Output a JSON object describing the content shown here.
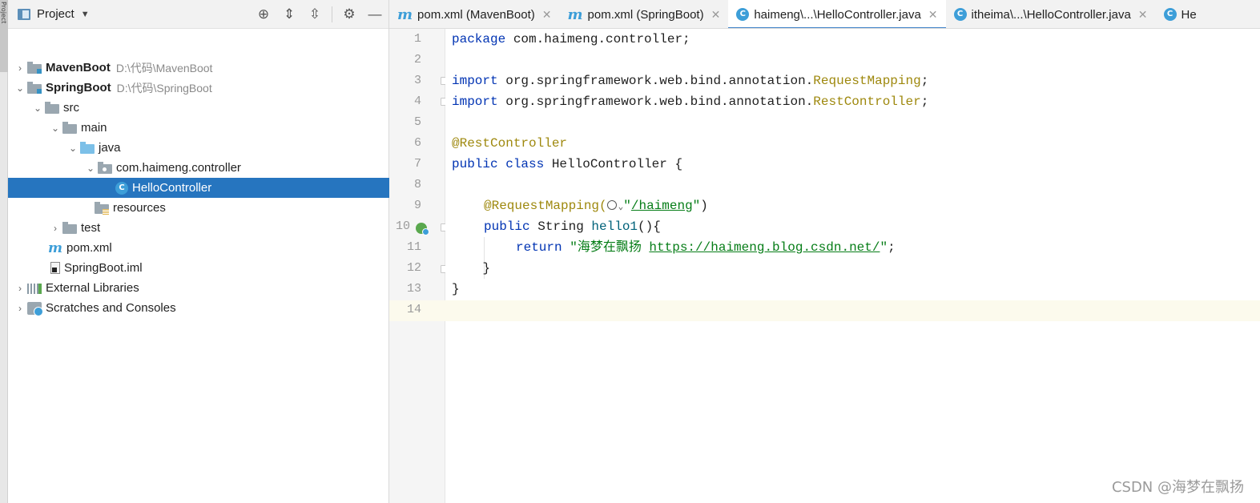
{
  "side_strip": {
    "label": "Project"
  },
  "project_panel": {
    "title": "Project",
    "tools": [
      "locate-icon",
      "expand-all-icon",
      "collapse-all-icon",
      "gear-icon",
      "minimize-icon"
    ],
    "tree": [
      {
        "label": "MavenBoot",
        "path": "D:\\代码\\MavenBoot",
        "bold": true
      },
      {
        "label": "SpringBoot",
        "path": "D:\\代码\\SpringBoot",
        "bold": true
      },
      {
        "label": "src"
      },
      {
        "label": "main"
      },
      {
        "label": "java"
      },
      {
        "label": "com.haimeng.controller"
      },
      {
        "label": "HelloController",
        "selected": true
      },
      {
        "label": "resources"
      },
      {
        "label": "test"
      },
      {
        "label": "pom.xml"
      },
      {
        "label": "SpringBoot.iml"
      },
      {
        "label": "External Libraries"
      },
      {
        "label": "Scratches and Consoles"
      }
    ]
  },
  "tabs": [
    {
      "label": "pom.xml (MavenBoot)",
      "icon": "maven-icon"
    },
    {
      "label": "pom.xml (SpringBoot)",
      "icon": "maven-icon"
    },
    {
      "label": "haimeng\\...\\HelloController.java",
      "icon": "class-icon",
      "active": true
    },
    {
      "label": "itheima\\...\\HelloController.java",
      "icon": "class-icon"
    },
    {
      "label": "He",
      "icon": "class-icon"
    }
  ],
  "editor": {
    "line_numbers": [
      "1",
      "2",
      "3",
      "4",
      "5",
      "6",
      "7",
      "8",
      "9",
      "10",
      "11",
      "12",
      "13",
      "14"
    ],
    "current_line": 14,
    "code": {
      "l1_kw": "package",
      "l1_rest": " com.haimeng.controller;",
      "l3_kw": "import",
      "l3_pkg": " org.springframework.web.bind.annotation.",
      "l3_cls": "RequestMapping",
      "l3_end": ";",
      "l4_kw": "import",
      "l4_pkg": " org.springframework.web.bind.annotation.",
      "l4_cls": "RestController",
      "l4_end": ";",
      "l6_ann": "@RestController",
      "l7_kw": "public class",
      "l7_rest": " HelloController {",
      "l9_ann": "@RequestMapping(",
      "l9_str1": "\"",
      "l9_url": "/haimeng",
      "l9_str2": "\"",
      "l9_end": ")",
      "l10_kw": "public",
      "l10_type": " String ",
      "l10_fn": "hello1",
      "l10_end": "(){",
      "l11_kw": "return",
      "l11_str": " \"海梦在飘扬 ",
      "l11_url": "https://haimeng.blog.csdn.net/",
      "l11_str2": "\"",
      "l11_end": ";",
      "l12": "    }",
      "l13": "}"
    }
  },
  "watermark": "CSDN @海梦在飘扬"
}
